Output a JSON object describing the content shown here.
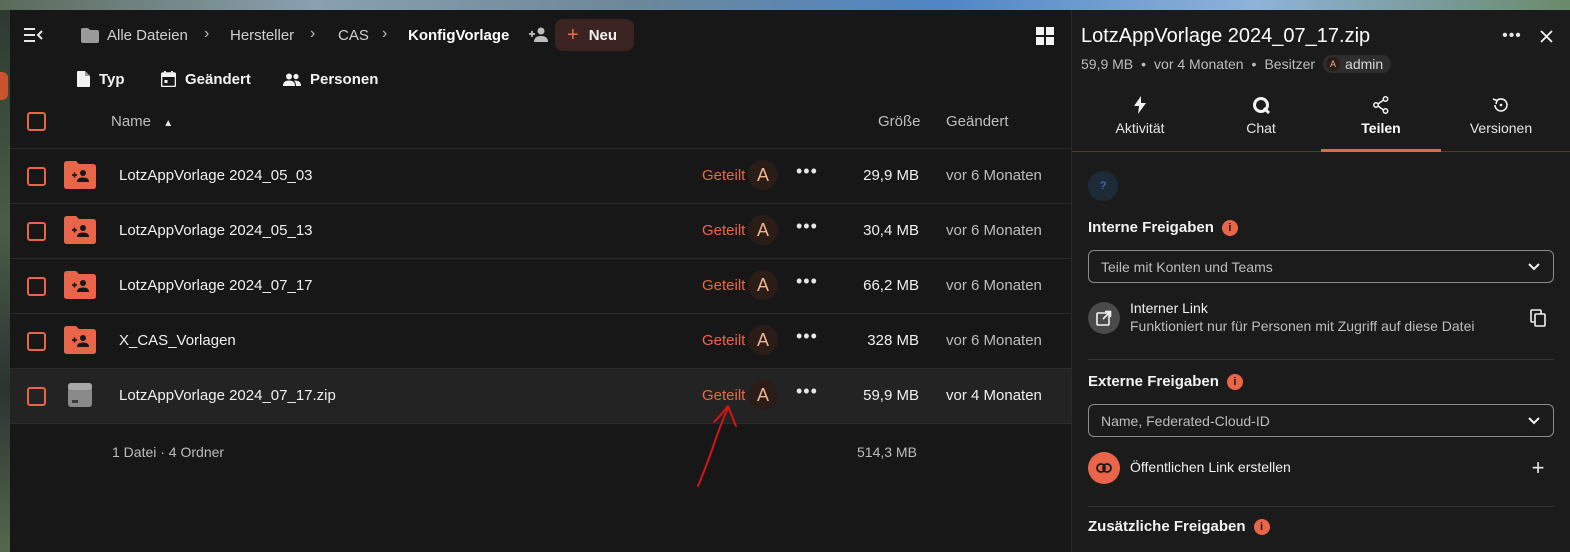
{
  "breadcrumb": {
    "items": [
      "Alle Dateien",
      "Hersteller",
      "CAS",
      "KonfigVorlage"
    ]
  },
  "toolbar": {
    "new_label": "Neu"
  },
  "filters": [
    "Typ",
    "Geändert",
    "Personen"
  ],
  "columns": {
    "name": "Name",
    "size": "Größe",
    "changed": "Geändert"
  },
  "files": [
    {
      "name": "LotzAppVorlage 2024_05_03",
      "type": "shared-folder",
      "shared": "Geteilt",
      "avatar": "A",
      "size": "29,9 MB",
      "changed": "vor 6 Monaten"
    },
    {
      "name": "LotzAppVorlage 2024_05_13",
      "type": "shared-folder",
      "shared": "Geteilt",
      "avatar": "A",
      "size": "30,4 MB",
      "changed": "vor 6 Monaten"
    },
    {
      "name": "LotzAppVorlage 2024_07_17",
      "type": "shared-folder",
      "shared": "Geteilt",
      "avatar": "A",
      "size": "66,2 MB",
      "changed": "vor 6 Monaten"
    },
    {
      "name": "X_CAS_Vorlagen",
      "type": "shared-folder",
      "shared": "Geteilt",
      "avatar": "A",
      "size": "328 MB",
      "changed": "vor 6 Monaten"
    },
    {
      "name": "LotzAppVorlage 2024_07_17.zip",
      "type": "zip-file",
      "shared": "Geteilt",
      "avatar": "A",
      "size": "59,9 MB",
      "changed": "vor 4 Monaten"
    }
  ],
  "summary": {
    "counts": "1 Datei · 4 Ordner",
    "total_size": "514,3 MB"
  },
  "sidebar": {
    "title": "LotzAppVorlage 2024_07_17.zip",
    "size": "59,9 MB",
    "modified": "vor 4 Monaten",
    "owner_label": "Besitzer",
    "owner_avatar": "A",
    "owner_name": "admin",
    "tabs": [
      "Aktivität",
      "Chat",
      "Teilen",
      "Versionen"
    ],
    "active_tab": "Teilen",
    "help_mark": "?",
    "info_mark": "i",
    "internal": {
      "heading": "Interne Freigaben",
      "select_placeholder": "Teile mit Konten und Teams",
      "link_title": "Interner Link",
      "link_desc": "Funktioniert nur für Personen mit Zugriff auf diese Datei"
    },
    "external": {
      "heading": "Externe Freigaben",
      "select_placeholder": "Name, Federated-Cloud-ID",
      "public_link": "Öffentlichen Link erstellen"
    },
    "additional": {
      "heading": "Zusätzliche Freigaben"
    }
  },
  "colors": {
    "accent": "#e8654a",
    "background": "#171717",
    "sidebar_background": "#1b1b1b",
    "shared_text": "#ee6548"
  },
  "annotation": {
    "type": "red-hand-drawn-arrow",
    "points_to": "Geteilt"
  }
}
